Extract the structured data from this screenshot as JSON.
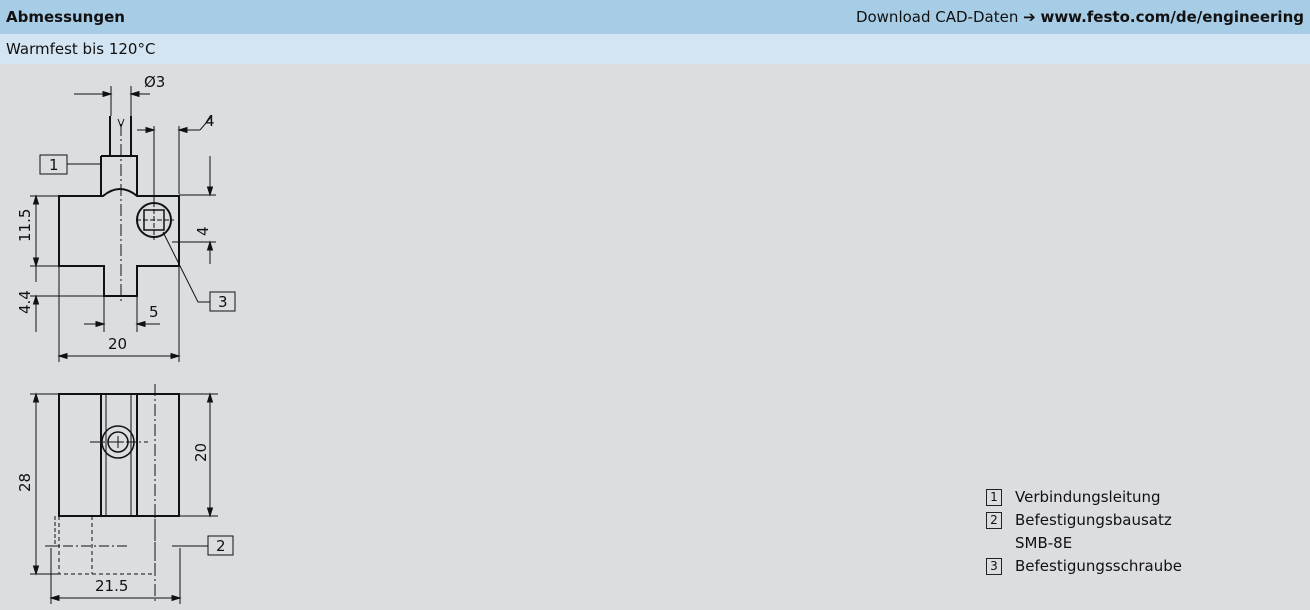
{
  "header": {
    "title": "Abmessungen",
    "download_label": "Download CAD-Daten",
    "download_url": "www.festo.com/de/engineering"
  },
  "subheader": {
    "text": "Warmfest bis 120°C"
  },
  "drawing": {
    "dimensions": {
      "diameter": "Ø3",
      "width_top_right": "4",
      "height_left": "11.5",
      "height_right": "4",
      "bottom_left": "4.4",
      "step": "5",
      "width": "20",
      "side_height": "28",
      "side_inner_height": "20",
      "side_width": "21.5"
    },
    "callouts": {
      "c1": "1",
      "c2": "2",
      "c3": "3"
    }
  },
  "legend": {
    "items": [
      {
        "num": "1",
        "label": "Verbindungsleitung"
      },
      {
        "num": "2",
        "label": "Befestigungsbausatz",
        "continuation": "SMB-8E"
      },
      {
        "num": "3",
        "label": "Befestigungsschraube"
      }
    ]
  }
}
